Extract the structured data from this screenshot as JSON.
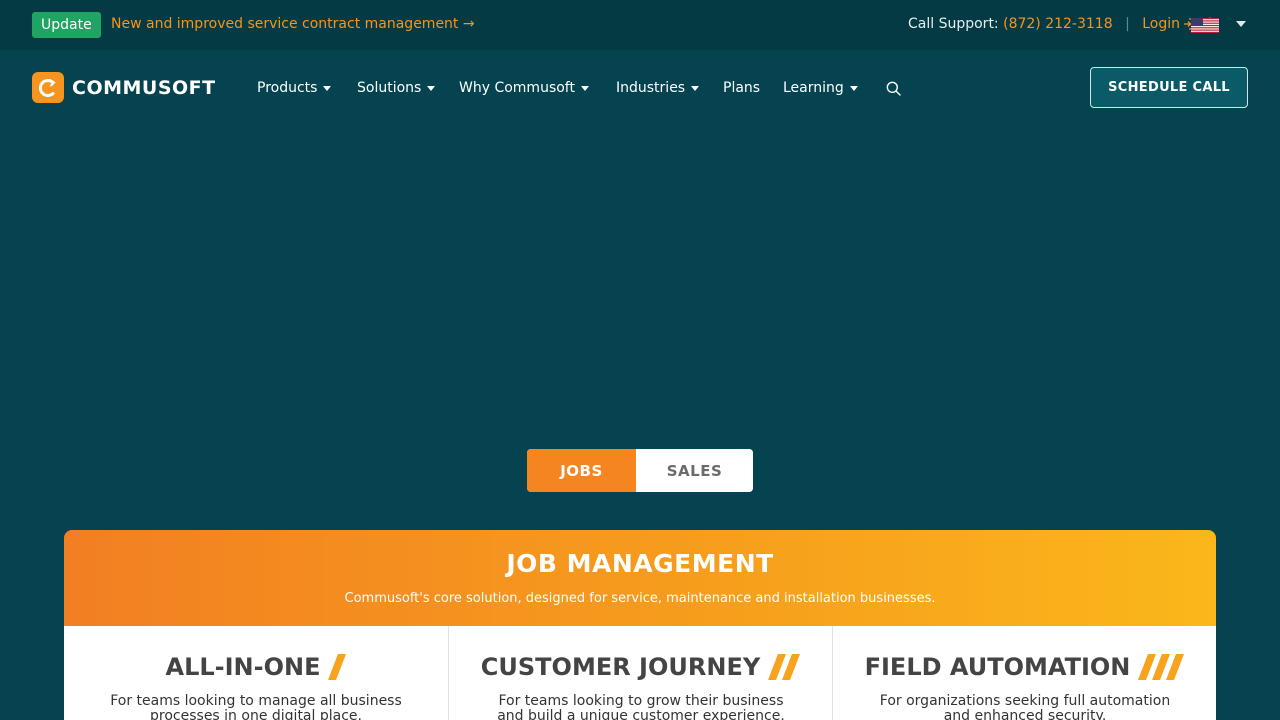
{
  "topbar": {
    "badge": "Update",
    "announcement": "New and improved service contract management →",
    "support_label": "Call Support:",
    "support_phone": "(872) 212-3118",
    "login_label": "Login",
    "separator": "|"
  },
  "brand": {
    "name": "COMMUSOFT",
    "accent": "#f7941d",
    "background": "#04434f"
  },
  "nav": {
    "items": [
      {
        "label": "Products",
        "has_dropdown": true
      },
      {
        "label": "Solutions",
        "has_dropdown": true
      },
      {
        "label": "Why Commusoft",
        "has_dropdown": true
      },
      {
        "label": "Industries",
        "has_dropdown": true
      },
      {
        "label": "Plans",
        "has_dropdown": false
      },
      {
        "label": "Learning",
        "has_dropdown": true
      }
    ],
    "cta": "SCHEDULE CALL"
  },
  "toggle": {
    "options": [
      "JOBS",
      "SALES"
    ],
    "active": "JOBS"
  },
  "card": {
    "title": "JOB MANAGEMENT",
    "subtitle": "Commusoft's core solution, designed for service, maintenance and installation businesses.",
    "columns": [
      {
        "title": "ALL-IN-ONE",
        "slashes": 1,
        "description": "For teams looking to manage all business processes in one digital place."
      },
      {
        "title": "CUSTOMER JOURNEY",
        "slashes": 2,
        "description": "For teams looking to grow their business and build a unique customer experience."
      },
      {
        "title": "FIELD AUTOMATION",
        "slashes": 3,
        "description": "For organizations seeking full automation and enhanced security."
      }
    ]
  }
}
